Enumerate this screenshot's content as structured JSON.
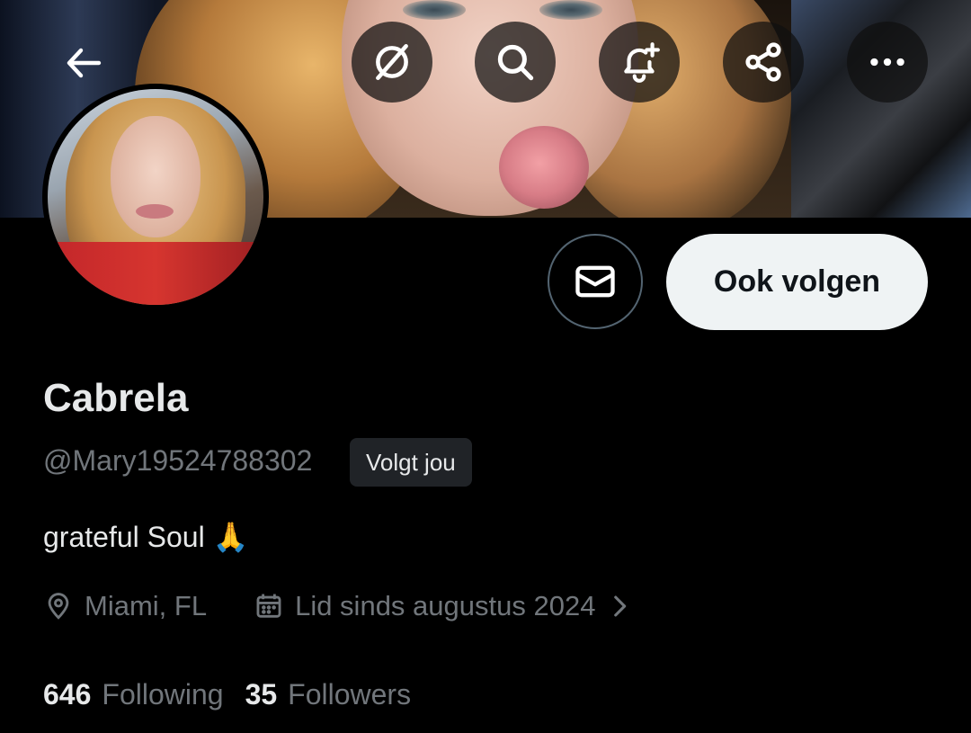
{
  "profile": {
    "name": "Cabrela",
    "handle": "@Mary19524788302",
    "follows_you_badge": "Volgt jou",
    "bio": "grateful Soul 🙏",
    "location": "Miami, FL",
    "joined": "Lid sinds augustus 2024",
    "following_count": "646",
    "following_label": "Following",
    "followers_count": "35",
    "followers_label": "Followers"
  },
  "actions": {
    "follow_back_label": "Ook volgen"
  },
  "icons": {
    "back": "arrow-left-icon",
    "grok": "grok-icon",
    "search": "search-icon",
    "notifications": "bell-plus-icon",
    "share": "share-icon",
    "more": "more-horizontal-icon",
    "message": "envelope-icon",
    "location": "location-pin-icon",
    "calendar": "calendar-icon",
    "chevron": "chevron-right-icon"
  },
  "colors": {
    "background": "#000000",
    "primary_text": "#e7e9ea",
    "secondary_text": "#71767b",
    "follow_button_bg": "#eff3f4",
    "badge_bg": "#202327"
  }
}
